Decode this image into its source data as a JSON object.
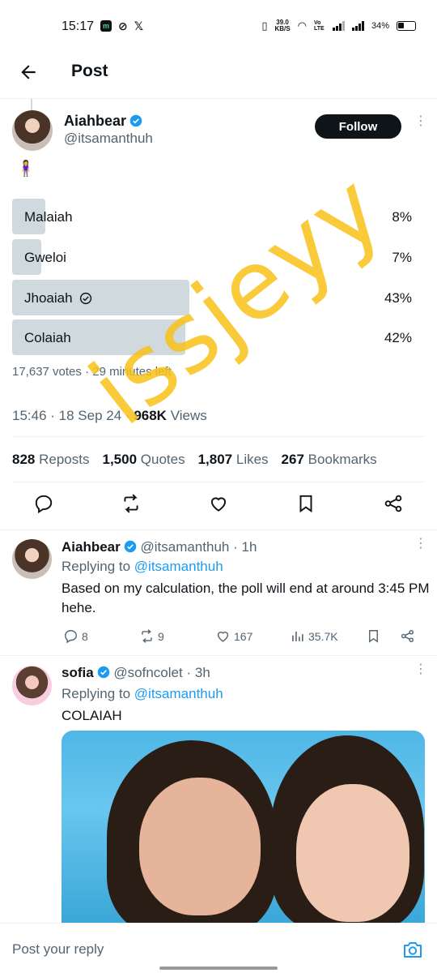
{
  "status_bar": {
    "time": "15:17",
    "net_speed_value": "39.0",
    "net_speed_unit": "KB/S",
    "volte_label": "Vo LTE",
    "battery": "34%"
  },
  "header": {
    "title": "Post"
  },
  "post": {
    "author_name": "Aiahbear",
    "author_handle": "@itsamanthuh",
    "follow_label": "Follow",
    "emoji": "🧍‍♀️",
    "poll": {
      "options": [
        {
          "label": "Malaiah",
          "percent": "8%",
          "share": 0.08,
          "winner": false
        },
        {
          "label": "Gweloi",
          "percent": "7%",
          "share": 0.07,
          "winner": false
        },
        {
          "label": "Jhoaiah",
          "percent": "43%",
          "share": 0.43,
          "winner": true
        },
        {
          "label": "Colaiah",
          "percent": "42%",
          "share": 0.42,
          "winner": false
        }
      ],
      "votes": "17,637 votes",
      "separator": "·",
      "time_left": "29 minutes left"
    },
    "timestamp": "15:46 · 18 Sep 24",
    "separator": "·",
    "views_count": "968K",
    "views_label": "Views",
    "stats": {
      "reposts_count": "828",
      "reposts_label": "Reposts",
      "quotes_count": "1,500",
      "quotes_label": "Quotes",
      "likes_count": "1,807",
      "likes_label": "Likes",
      "bookmarks_count": "267",
      "bookmarks_label": "Bookmarks"
    }
  },
  "replies": [
    {
      "name": "Aiahbear",
      "handle": "@itsamanthuh",
      "time": "1h",
      "separator": "·",
      "replying_prefix": "Replying to",
      "replying_to": "@itsamanthuh",
      "text": "Based on my calculation, the poll will end at around 3:45 PM hehe.",
      "comments": "8",
      "reposts": "9",
      "likes": "167",
      "views": "35.7K"
    },
    {
      "name": "sofia",
      "handle": "@sofncolet",
      "time": "3h",
      "separator": "·",
      "replying_prefix": "Replying to",
      "replying_to": "@itsamanthuh",
      "text": "COLAIAH"
    }
  ],
  "reply_bar": {
    "placeholder": "Post your reply"
  },
  "watermark": "issjeyy",
  "colors": {
    "accent": "#1d9bf0",
    "poll_fill": "#cfd9de",
    "text_primary": "#0f1419",
    "text_secondary": "#536471",
    "watermark": "#f8c21a"
  }
}
